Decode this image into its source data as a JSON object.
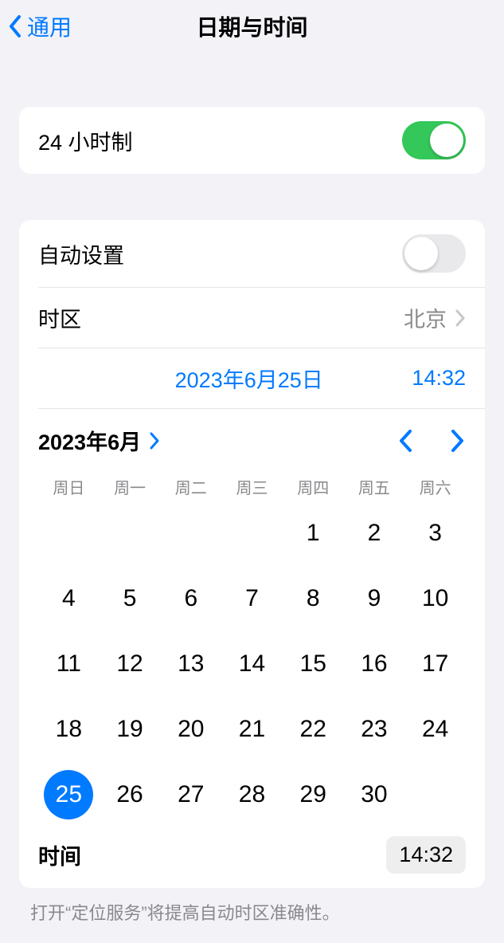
{
  "header": {
    "back_label": "通用",
    "title": "日期与时间"
  },
  "settings": {
    "twentyfour_hour_label": "24 小时制",
    "twentyfour_hour_enabled": true,
    "auto_set_label": "自动设置",
    "auto_set_enabled": false,
    "timezone_label": "时区",
    "timezone_value": "北京"
  },
  "date_summary": {
    "date": "2023年6月25日",
    "time": "14:32"
  },
  "calendar": {
    "month_label": "2023年6月",
    "weekdays": [
      "周日",
      "周一",
      "周二",
      "周三",
      "周四",
      "周五",
      "周六"
    ],
    "lead_blanks": 4,
    "days": [
      1,
      2,
      3,
      4,
      5,
      6,
      7,
      8,
      9,
      10,
      11,
      12,
      13,
      14,
      15,
      16,
      17,
      18,
      19,
      20,
      21,
      22,
      23,
      24,
      25,
      26,
      27,
      28,
      29,
      30
    ],
    "selected_day": 25
  },
  "time_picker": {
    "label": "时间",
    "value": "14:32"
  },
  "footer": {
    "note": "打开“定位服务”将提高自动时区准确性。"
  }
}
